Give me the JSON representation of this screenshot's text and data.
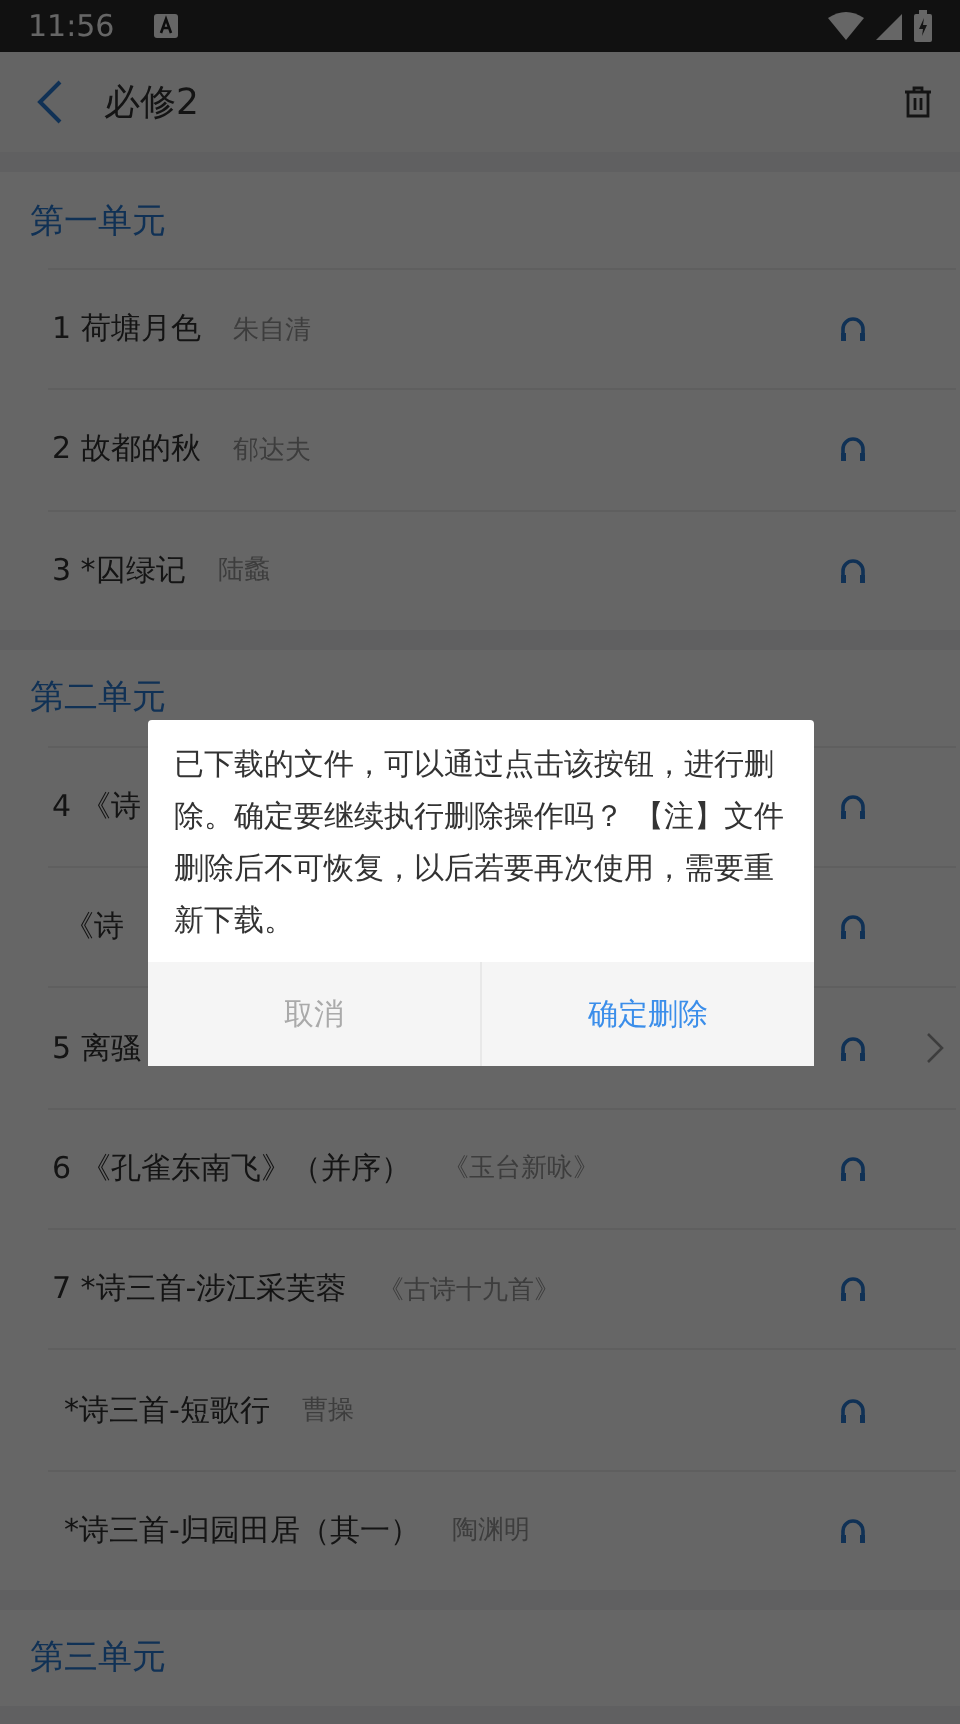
{
  "status_bar": {
    "time": "11:56"
  },
  "header": {
    "title": "必修2"
  },
  "units": [
    {
      "title": "第一单元",
      "lessons": [
        {
          "title": "1 荷塘月色",
          "author": "朱自清",
          "arrow": false
        },
        {
          "title": "2 故都的秋",
          "author": "郁达夫",
          "arrow": false
        },
        {
          "title": "3 *囚绿记",
          "author": "陆蠡",
          "arrow": false
        }
      ]
    },
    {
      "title": "第二单元",
      "lessons": [
        {
          "title": "4 《诗",
          "arrow": false,
          "children": [
            {
              "title": "《诗",
              "arrow": false
            }
          ]
        },
        {
          "title": "5 离骚",
          "arrow": true
        },
        {
          "title": "6 《孔雀东南飞》（并序）",
          "author": "《玉台新咏》",
          "arrow": false
        },
        {
          "title": "7 *诗三首-涉江采芙蓉",
          "author": "《古诗十九首》",
          "arrow": false,
          "children": [
            {
              "title": "*诗三首-短歌行",
              "author": "曹操",
              "arrow": false
            },
            {
              "title": "*诗三首-归园田居（其一）",
              "author": "陶渊明",
              "arrow": false
            }
          ]
        }
      ]
    },
    {
      "title": "第三单元"
    }
  ],
  "dialog": {
    "message": "已下载的文件，可以通过点击该按钮，进行删除。确定要继续执行删除操作吗？ 【注】文件删除后不可恢复，以后若要再次使用，需要重新下载。",
    "buttons": [
      {
        "label": "取消",
        "kind": "cancel"
      },
      {
        "label": "确定删除",
        "kind": "confirm"
      }
    ]
  }
}
